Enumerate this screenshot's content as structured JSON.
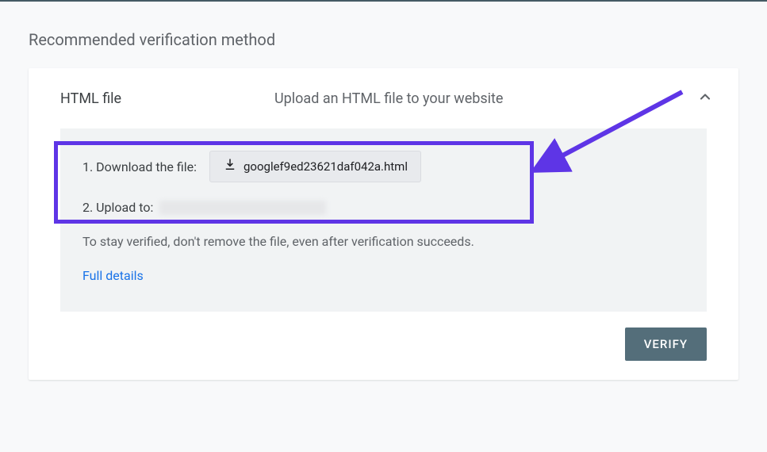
{
  "heading": "Recommended verification method",
  "card": {
    "title": "HTML file",
    "subtitle": "Upload an HTML file to your website"
  },
  "steps": {
    "download_label": "1. Download the file:",
    "filename": "googlef9ed23621daf042a.html",
    "upload_label": "2. Upload to:"
  },
  "note_text": "To stay verified, don't remove the file, even after verification succeeds.",
  "full_details_label": "Full details",
  "verify_label": "VERIFY"
}
